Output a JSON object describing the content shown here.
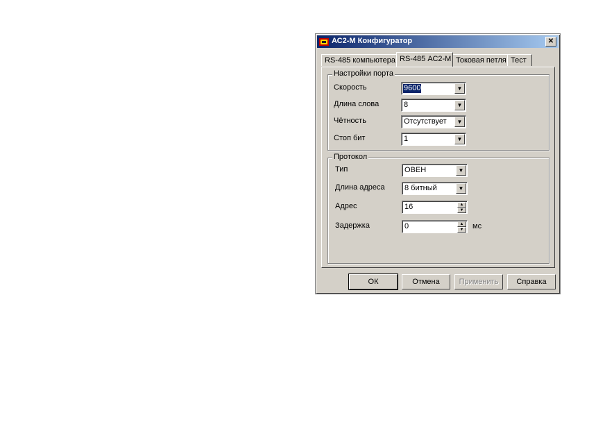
{
  "window": {
    "title": "АС2-М Конфигуратор",
    "close": "✕"
  },
  "tabs": [
    "RS-485 компьютера",
    "RS-485 АС2-М",
    "Токовая петля",
    "Тест"
  ],
  "port_group": {
    "title": "Настройки порта",
    "fields": [
      {
        "label": "Скорость",
        "value": "9600"
      },
      {
        "label": "Длина слова",
        "value": "8"
      },
      {
        "label": "Чётность",
        "value": "Отсутствует"
      },
      {
        "label": "Стоп бит",
        "value": "1"
      }
    ]
  },
  "protocol_group": {
    "title": "Протокол",
    "type_label": "Тип",
    "type_value": "ОВЕН",
    "addrlen_label": "Длина адреса",
    "addrlen_value": "8 битный",
    "addr_label": "Адрес",
    "addr_value": "16",
    "delay_label": "Задержка",
    "delay_value": "0",
    "delay_unit": "мс"
  },
  "buttons": {
    "ok": "ОК",
    "cancel": "Отмена",
    "apply": "Применить",
    "help": "Справка"
  },
  "icons": {
    "arrow": "▼",
    "up": "▲",
    "down": "▼"
  }
}
